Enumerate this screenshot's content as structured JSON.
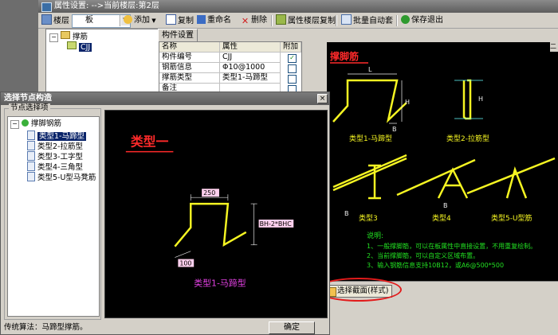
{
  "window": {
    "title": "属性设置: -->当前楼层:第2层"
  },
  "toolbar": {
    "floor_label": "楼层",
    "floor_select": "板",
    "add_label": "添加",
    "copy_label": "复制",
    "rename_label": "重命名",
    "delete_label": "删除",
    "floor_copy_label": "属性楼层复制",
    "batch_label": "批量自动套",
    "save_exit_label": "保存退出"
  },
  "tree": {
    "root": "撑筋",
    "child": "CJJ"
  },
  "tab": {
    "label": "构件设置"
  },
  "grid": {
    "headers": [
      "名称",
      "属性",
      "附加"
    ],
    "rows": [
      {
        "name": "构件编号",
        "value": "CJJ",
        "checked": true
      },
      {
        "name": "钢筋信息",
        "value": "Φ10@1000",
        "checked": false
      },
      {
        "name": "撑筋类型",
        "value": "类型1-马蹄型",
        "checked": false
      },
      {
        "name": "备注",
        "value": "",
        "checked": false
      }
    ]
  },
  "preview": {
    "title": "撑脚筋",
    "labels": {
      "L": "L",
      "H": "H",
      "B": "B"
    },
    "type_captions": [
      "类型1-马蹄型",
      "类型2-拉筋型",
      "类型3",
      "类型4",
      "类型5-U型筋"
    ],
    "notes_title": "说明:",
    "notes": [
      "1、一般撑脚筋，可以在板属性中直接设置，不用重复绘制。",
      "2、当前撑脚筋，可以自定义区域布置。",
      "3、输入钢筋信息支持10B12，或A6@500*500"
    ],
    "side_tab": "二维"
  },
  "select_button": "选择截面(样式)",
  "dialog": {
    "title": "选择节点构造",
    "group_label": "节点选择项",
    "tree_root": "撑脚钢筋",
    "items": [
      "类型1-马蹄型",
      "类型2-拉筋型",
      "类型3-工字型",
      "类型4-三角型",
      "类型5-U型马凳筋"
    ],
    "canvas": {
      "heading": "类型一",
      "dim_top": "250",
      "dim_side": "BH-2*BHC",
      "dim_bottom": "100",
      "caption": "类型1-马蹄型"
    },
    "status": "传统算法：马蹄型撑筋。",
    "ok_label": "确定",
    "close_label": "×"
  },
  "colors": {
    "rebar_yellow": "#f5f522",
    "note_green": "#22e022",
    "heading_red": "#ff2a2a",
    "highlight_red": "#e21b1b",
    "dim_pink": "#ff9ad6",
    "caption_magenta": "#e040e0"
  }
}
